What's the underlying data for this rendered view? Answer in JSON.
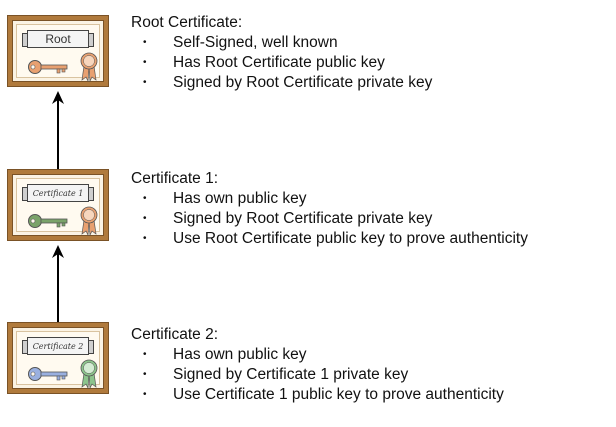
{
  "colors": {
    "frame": "#b07a3c",
    "root_key": "#e8a070",
    "cert1_key": "#7aa36a",
    "cert2_key": "#9ab0e0",
    "root_seal": "#e8a070",
    "cert1_seal": "#e8a070",
    "cert2_seal": "#8cc48c"
  },
  "certificates": [
    {
      "banner": "Root",
      "title": "Root Certificate:",
      "points": [
        "Self-Signed, well known",
        "Has Root Certificate public key",
        "Signed by Root Certificate private key"
      ]
    },
    {
      "banner": "Certificate 1",
      "title": "Certificate 1:",
      "points": [
        "Has own public key",
        "Signed by Root Certificate private key",
        "Use Root Certificate public key to prove authenticity"
      ]
    },
    {
      "banner": "Certificate 2",
      "title": "Certificate 2:",
      "points": [
        "Has own public key",
        "Signed by Certificate 1 private key",
        "Use Certificate 1 public key to prove authenticity"
      ]
    }
  ]
}
